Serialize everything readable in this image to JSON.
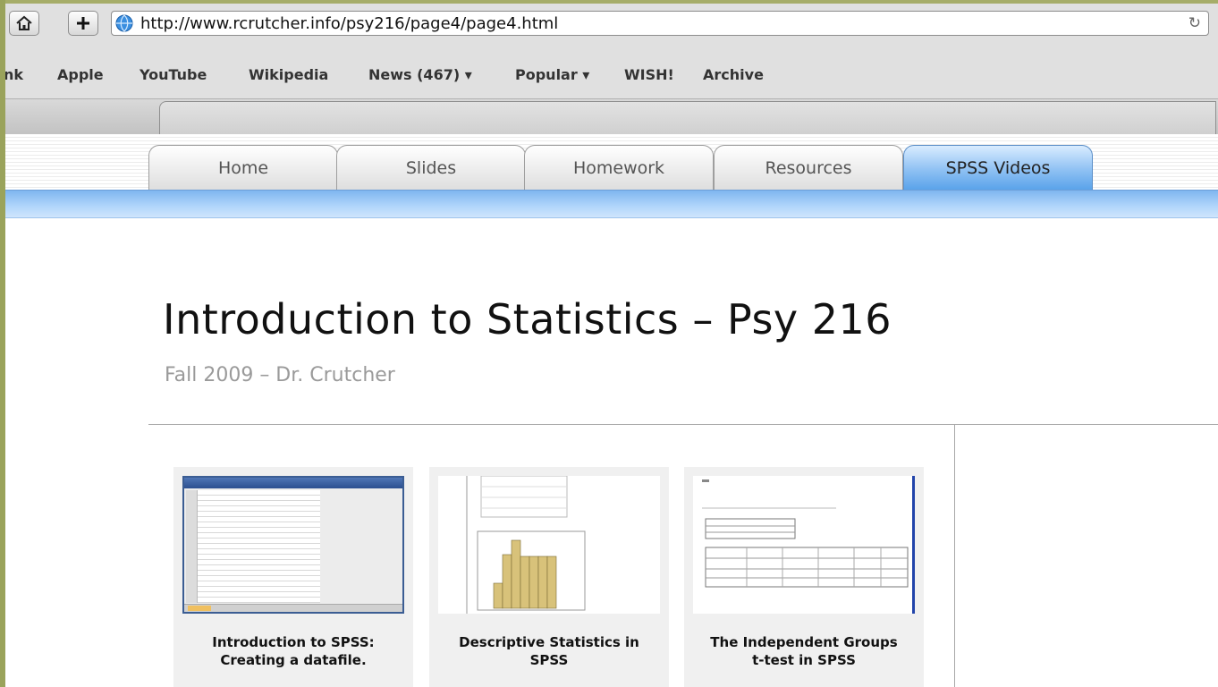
{
  "browser": {
    "url": "http://www.rcrutcher.info/psy216/page4/page4.html",
    "bookmarks": [
      "nk",
      "Apple",
      "YouTube",
      "Wikipedia",
      "News (467) ▾",
      "Popular ▾",
      "WISH!",
      "Archive"
    ]
  },
  "site_nav": {
    "tabs": [
      "Home",
      "Slides",
      "Homework",
      "Resources",
      "SPSS Videos"
    ],
    "active_tab": "SPSS Videos",
    "active_color": "#6aaeef"
  },
  "page": {
    "title": "Introduction to Statistics – Psy 216",
    "subtitle": "Fall 2009 – Dr. Crutcher"
  },
  "videos": [
    {
      "caption_line1": "Introduction to SPSS:",
      "caption_line2": "Creating a datafile."
    },
    {
      "caption_line1": "Descriptive Statistics in",
      "caption_line2": "SPSS"
    },
    {
      "caption_line1": "The Independent Groups",
      "caption_line2": "t-test in SPSS"
    }
  ]
}
